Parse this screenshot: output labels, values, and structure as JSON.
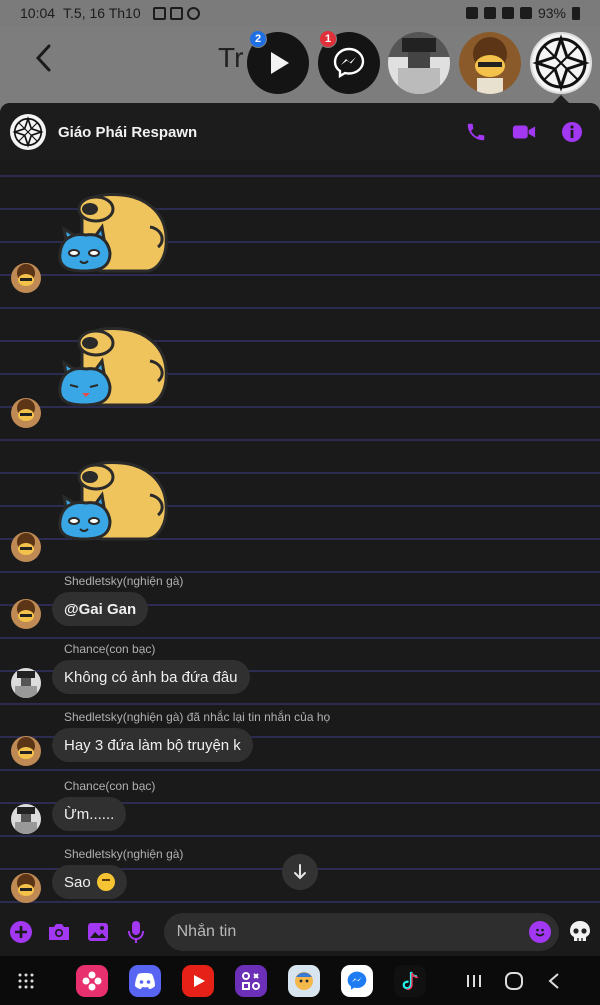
{
  "status_bar": {
    "time": "10:04",
    "date": "T.5, 16 Th10",
    "battery": "93%"
  },
  "background_chat": {
    "title_partial": "Tr"
  },
  "chat_heads": {
    "play_badge": "2",
    "messenger_badge": "1"
  },
  "header": {
    "group_name": "Giáo Phái Respawn"
  },
  "messages": [
    {
      "sender": "Shedletsky(nghiện gà)",
      "text": "@Gai Gan"
    },
    {
      "sender": "Chance(con bạc)",
      "text": "Không có ảnh ba đứa đâu"
    },
    {
      "sender": "Shedletsky(nghiện gà) đã nhắc lại tin nhắn của họ",
      "text": "Hay 3 đứa làm bộ truyện k"
    },
    {
      "sender": "Chance(con bạc)",
      "text": "Ừm......"
    },
    {
      "sender": "Shedletsky(nghiện gà)",
      "text": "Sao"
    }
  ],
  "composer": {
    "placeholder": "Nhắn tin"
  },
  "colors": {
    "accent": "#a338f2",
    "panel": "#1a1a1b",
    "bubble": "#303030",
    "line": "#2c2c50"
  },
  "icons": {
    "header": [
      "phone-icon",
      "video-icon",
      "info-icon"
    ],
    "composer": [
      "plus-icon",
      "camera-icon",
      "image-icon",
      "mic-icon",
      "emoji-icon",
      "skull-icon"
    ],
    "dock": [
      "app-drawer-icon",
      "flower-app-icon",
      "discord-icon",
      "youtube-icon",
      "game-launcher-icon",
      "face-app-icon",
      "messenger-icon",
      "tiktok-icon"
    ]
  }
}
